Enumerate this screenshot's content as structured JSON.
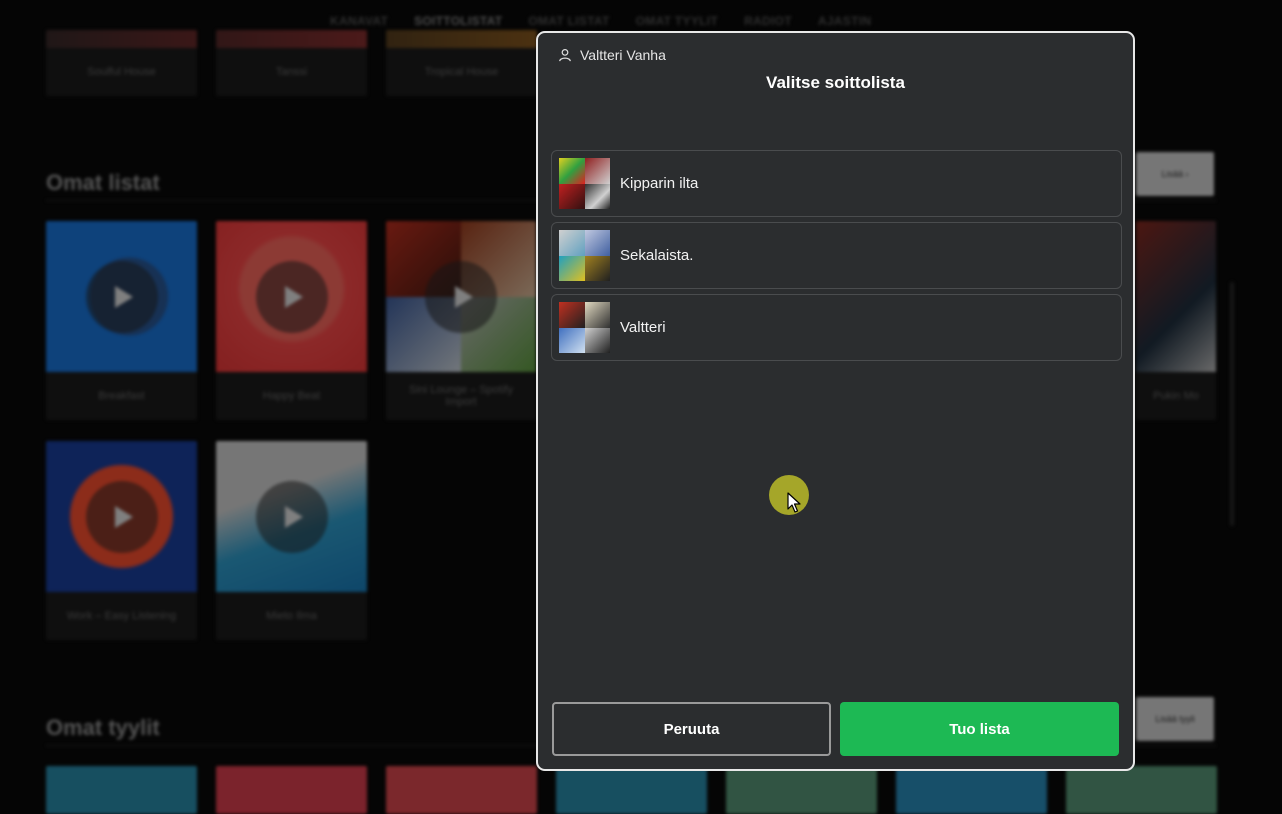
{
  "background": {
    "nav": [
      "KANAVAT",
      "SOITTOLISTAT",
      "OMAT LISTAT",
      "OMAT TYYLIT",
      "RADIOT",
      "AJASTIN"
    ],
    "nav_active": 1,
    "top_row_labels": [
      "Soulful House",
      "Tanssi",
      "Tropical House"
    ],
    "sections": {
      "omat_listat": "Omat listat",
      "omat_tyylit": "Omat tyylit"
    },
    "omat_listat_tiles": [
      "Breakfast",
      "Happy Beat",
      "Sini Lounge – Spotify Import",
      "Work – Easy Listening",
      "Mieto Ilma"
    ],
    "right_tile_label": "Pukin Mo",
    "side_buttons": [
      "Lisää ›",
      "Lisää tyyli"
    ]
  },
  "dialog": {
    "user_name": "Valtteri Vanha",
    "title": "Valitse soittolista",
    "playlists": [
      {
        "name": "Kipparin ilta"
      },
      {
        "name": "Sekalaista."
      },
      {
        "name": "Valtteri"
      }
    ],
    "cancel_label": "Peruuta",
    "confirm_label": "Tuo lista"
  },
  "colors": {
    "dialog_bg": "#2b2d2f",
    "confirm_green": "#1db954",
    "border": "#e8e8e8"
  },
  "icons": {
    "user": "user-icon",
    "play": "play-icon",
    "cursor": "mouse-pointer-icon"
  }
}
